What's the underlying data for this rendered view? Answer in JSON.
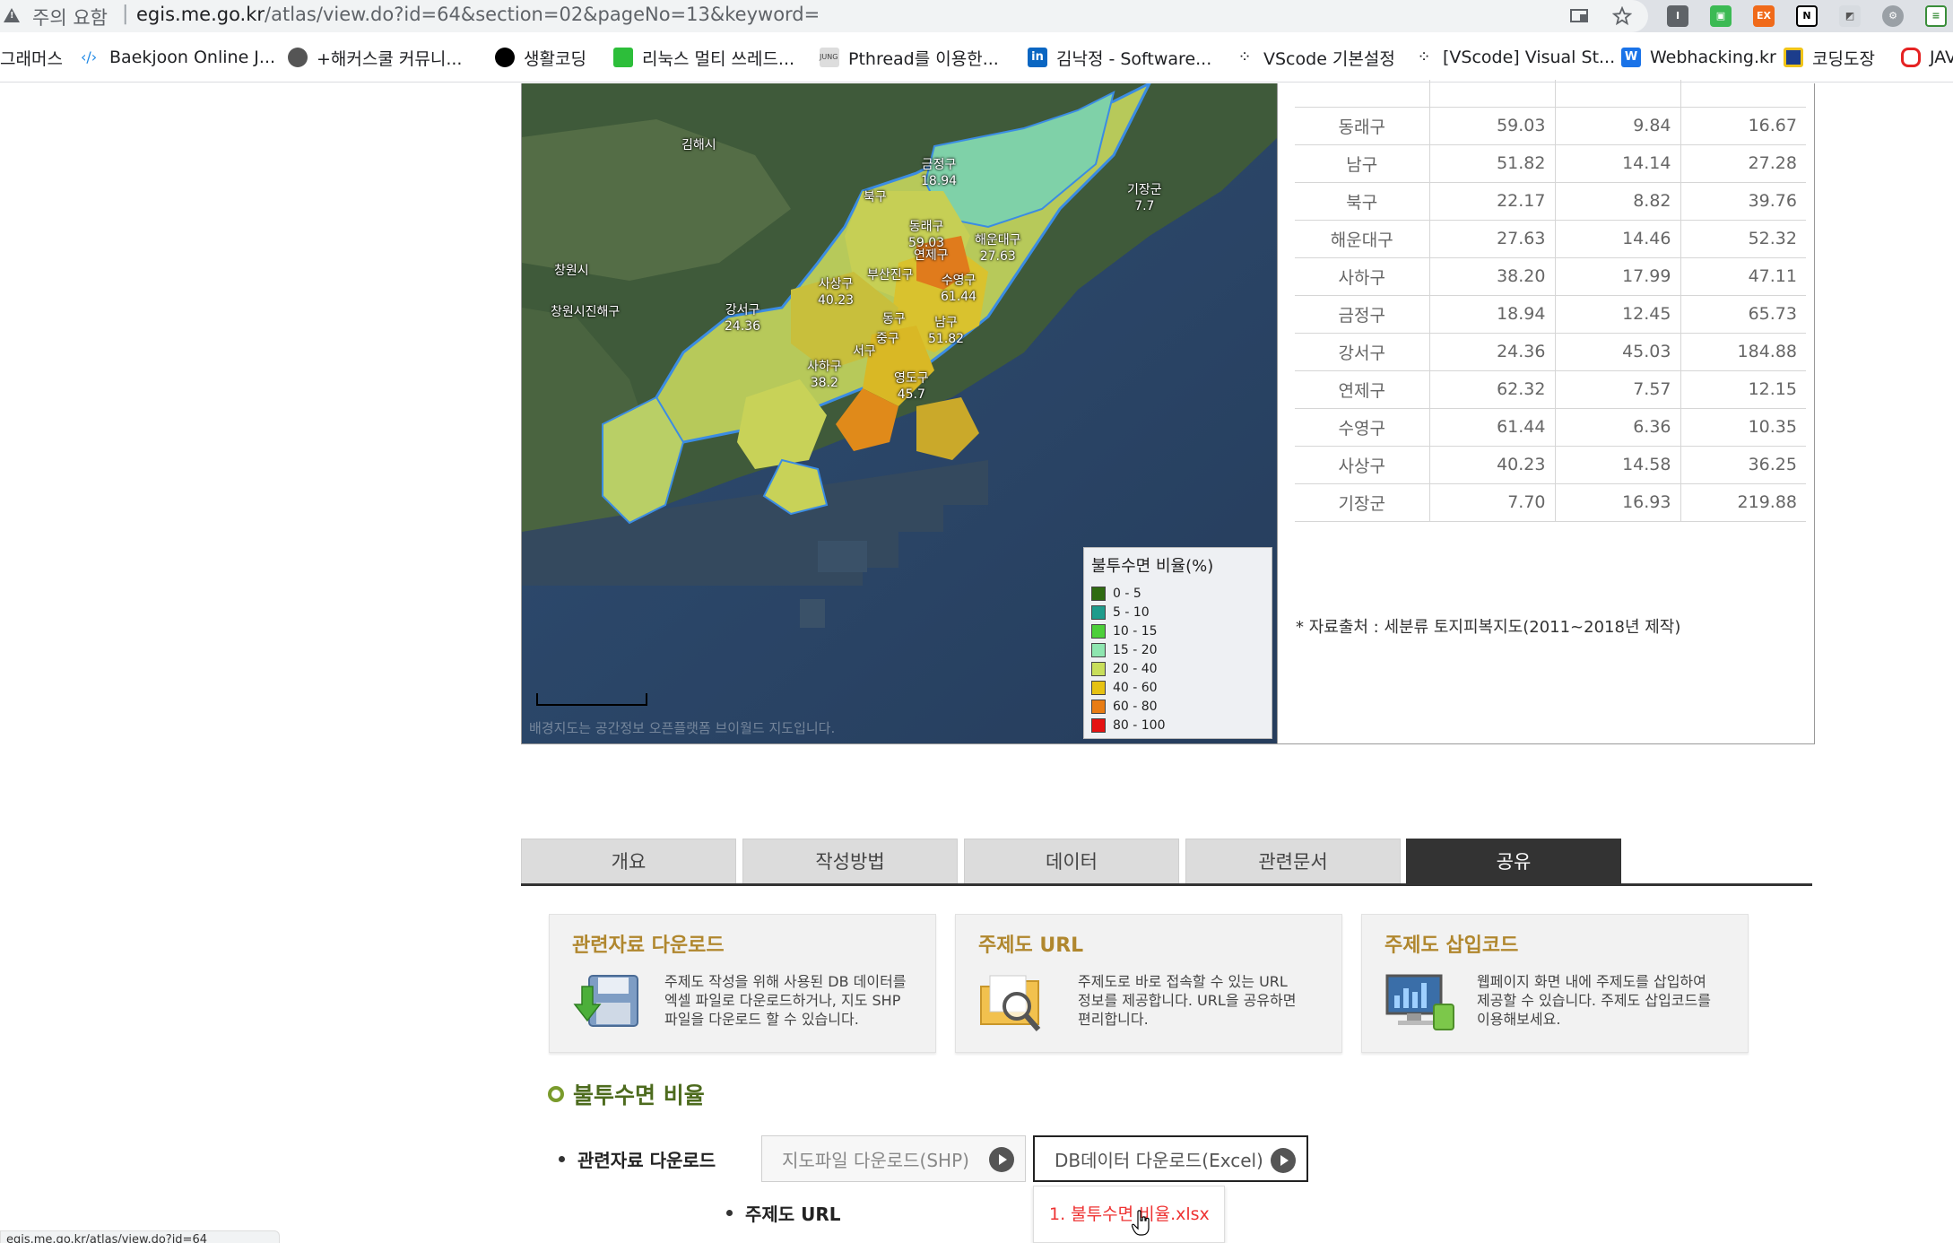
{
  "browser": {
    "security_label": "주의 요함",
    "url_host": "egis.me.go.kr",
    "url_path": "/atlas/view.do?id=64&section=02&pageNo=13&keyword=",
    "bookmarks": [
      {
        "label": "그래머스",
        "icon_color": "#ffffff"
      },
      {
        "label": "Baekjoon Online J...",
        "icon_color": "#1e88e5"
      },
      {
        "label": "+해커스쿨 커뮤니...",
        "icon_color": "#555555"
      },
      {
        "label": "생활코딩",
        "icon_color": "#000000"
      },
      {
        "label": "리눅스 멀티 쓰레드...",
        "icon_color": "#2dbe3a"
      },
      {
        "label": "Pthread를 이용한...",
        "icon_color": "#999999"
      },
      {
        "label": "김낙정 - Software...",
        "icon_color": "#0a66c2"
      },
      {
        "label": "VScode 기본설정",
        "icon_color": "#222222"
      },
      {
        "label": "[VScode] Visual St...",
        "icon_color": "#222222"
      },
      {
        "label": "Webhacking.kr",
        "icon_color": "#1a73e8"
      },
      {
        "label": "코딩도장",
        "icon_color": "#1c3d8c"
      },
      {
        "label": "JAV",
        "icon_color": "#e52222"
      }
    ]
  },
  "map": {
    "labels": [
      {
        "name": "기장군",
        "value": "7.7"
      },
      {
        "name": "김해시",
        "value": ""
      },
      {
        "name": "금정구",
        "value": "18.94"
      },
      {
        "name": "북구",
        "value": ""
      },
      {
        "name": "동래구",
        "value": "59.03"
      },
      {
        "name": "연제구",
        "value": ""
      },
      {
        "name": "해운대구",
        "value": "27.63"
      },
      {
        "name": "창원시",
        "value": ""
      },
      {
        "name": "사상구",
        "value": "40.23"
      },
      {
        "name": "부산진구",
        "value": ""
      },
      {
        "name": "수영구",
        "value": "61.44"
      },
      {
        "name": "창원시진해구",
        "value": ""
      },
      {
        "name": "강서구",
        "value": "24.36"
      },
      {
        "name": "동구",
        "value": ""
      },
      {
        "name": "남구",
        "value": "51.82"
      },
      {
        "name": "중구",
        "value": ""
      },
      {
        "name": "서구",
        "value": ""
      },
      {
        "name": "사하구",
        "value": "38.2"
      },
      {
        "name": "영도구",
        "value": "45.7"
      }
    ],
    "legend": {
      "title": "불투수면 비율(%)",
      "items": [
        {
          "range": "0 - 5",
          "color": "#2f6b12"
        },
        {
          "range": "5 - 10",
          "color": "#1f9c8c"
        },
        {
          "range": "10 - 15",
          "color": "#4ccf3a"
        },
        {
          "range": "15 - 20",
          "color": "#8ee6b0"
        },
        {
          "range": "20 - 40",
          "color": "#c8de5a"
        },
        {
          "range": "40 - 60",
          "color": "#e6c213"
        },
        {
          "range": "60 - 80",
          "color": "#e87c14"
        },
        {
          "range": "80 - 100",
          "color": "#e51212"
        }
      ]
    },
    "credit": "배경지도는 공간정보 오픈플랫폼 브이월드 지도입니다."
  },
  "table": {
    "partial_row": [
      "",
      "",
      "",
      ""
    ],
    "rows": [
      [
        "동래구",
        "59.03",
        "9.84",
        "16.67"
      ],
      [
        "남구",
        "51.82",
        "14.14",
        "27.28"
      ],
      [
        "북구",
        "22.17",
        "8.82",
        "39.76"
      ],
      [
        "해운대구",
        "27.63",
        "14.46",
        "52.32"
      ],
      [
        "사하구",
        "38.20",
        "17.99",
        "47.11"
      ],
      [
        "금정구",
        "18.94",
        "12.45",
        "65.73"
      ],
      [
        "강서구",
        "24.36",
        "45.03",
        "184.88"
      ],
      [
        "연제구",
        "62.32",
        "7.57",
        "12.15"
      ],
      [
        "수영구",
        "61.44",
        "6.36",
        "10.35"
      ],
      [
        "사상구",
        "40.23",
        "14.58",
        "36.25"
      ],
      [
        "기장군",
        "7.70",
        "16.93",
        "219.88"
      ]
    ],
    "source_note": "* 자료출처 : 세분류 토지피복지도(2011~2018년 제작)"
  },
  "tabs": [
    {
      "label": "개요",
      "active": false
    },
    {
      "label": "작성방법",
      "active": false
    },
    {
      "label": "데이터",
      "active": false
    },
    {
      "label": "관련문서",
      "active": false
    },
    {
      "label": "공유",
      "active": true
    }
  ],
  "cards": [
    {
      "title": "관련자료 다운로드",
      "desc": "주제도 작성을 위해 사용된 DB 데이터를\n엑셀 파일로 다운로드하거나, 지도 SHP\n파일을 다운로드 할 수 있습니다."
    },
    {
      "title": "주제도 URL",
      "desc": "주제도로 바로 접속할 수 있는 URL\n정보를 제공합니다. URL을 공유하면\n편리합니다."
    },
    {
      "title": "주제도 삽입코드",
      "desc": "웹페이지 화면 내에 주제도를 삽입하여\n제공할 수 있습니다. 주제도 삽입코드를\n이용해보세요."
    }
  ],
  "section": {
    "title": "불투수면 비율",
    "download_label": "관련자료 다운로드",
    "url_label": "주제도 URL",
    "btn_shp": "지도파일 다운로드(SHP)",
    "btn_excel": "DB데이터 다운로드(Excel)",
    "dropdown_item": "1. 불투수면 비율.xlsx"
  },
  "status_bar": "egis.me.go.kr/atlas/view.do?id=64"
}
